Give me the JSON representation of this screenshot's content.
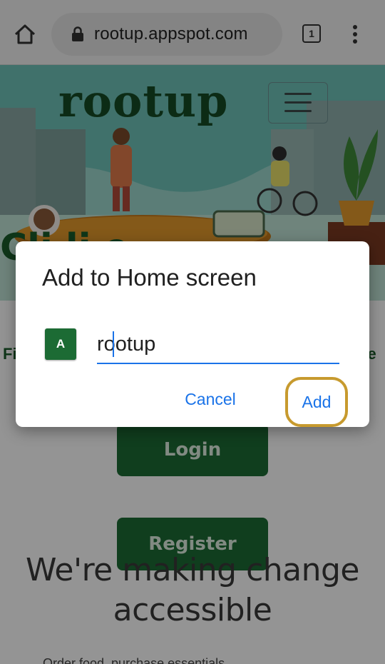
{
  "browser": {
    "url": "rootup.appspot.com",
    "tab_count": "1"
  },
  "page": {
    "logo": "rootup",
    "hero_heading": "Cli        li        e",
    "find_text_left": "Fi",
    "find_text_right": "ne",
    "login_label": "Login",
    "register_label": "Register",
    "tagline": "We're making change accessible",
    "subtext": "Order food, purchase essentials"
  },
  "dialog": {
    "title": "Add to Home screen",
    "icon_letter": "A",
    "name_value": "rootup",
    "cancel_label": "Cancel",
    "add_label": "Add"
  },
  "colors": {
    "accent": "#1a73e8",
    "brand_green": "#1c6b34",
    "highlight": "#c79a2e"
  }
}
